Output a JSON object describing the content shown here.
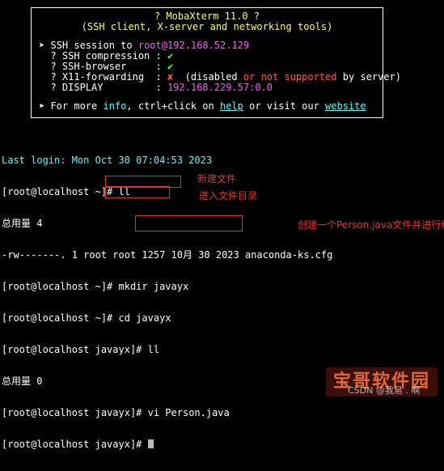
{
  "banner": {
    "title": "? MobaXterm 11.0 ?",
    "subtitle": "(SSH client, X-server and networking tools)",
    "session": {
      "bullet": "➤",
      "prefix": "SSH session to ",
      "user": "root",
      "host": "@192.168.52.129"
    },
    "options": [
      {
        "label": "  ? SSH compression : ",
        "value": "✔"
      },
      {
        "label": "  ? SSH-browser     : ",
        "value": "✔"
      },
      {
        "label": "  ? X11-forwarding  : ",
        "value": "✘",
        "note_a": "  (disabled ",
        "note_or": "or",
        "note_b": " not supported",
        "note_c": " by server)"
      },
      {
        "label": "  ? DISPLAY         : ",
        "value": "192.168.229.57:0.0"
      }
    ],
    "info": {
      "bullet": "➤",
      "part1": " For more ",
      "info": "info",
      "part2": ", ctrl+click on ",
      "help": "help",
      "part3": " or visit our ",
      "website": "website"
    }
  },
  "terminal": {
    "last_login": "Last login: Mon Oct 30 07:04:53 2023",
    "l2": "[root@localhost ~]# ll",
    "l3": "总用量 4",
    "l4": "-rw-------. 1 root root 1257 10月 30 2023 anaconda-ks.cfg",
    "l5": "[root@localhost ~]# mkdir javayx",
    "l6": "[root@localhost ~]# cd javayx",
    "l7": "[root@localhost javayx]# ll",
    "l8": "总用量 0",
    "l9": "[root@localhost javayx]# vi Person.java",
    "l10": "[root@localhost javayx]# "
  },
  "annotations": {
    "a1": "新建文件",
    "a2": "进入文件目录",
    "a3": "创建一个Person.java文件并进行编辑"
  },
  "watermark": {
    "badge": "宝哥软件园",
    "csdn": "CSDN @我易 . 啊"
  },
  "colors": {
    "background": "#000000",
    "banner_text": "#ffff55",
    "user": "#ff55ff",
    "error": "#ff5555",
    "link": "#55ffff",
    "ok": "#55ff55",
    "annotation": "#e23030"
  }
}
